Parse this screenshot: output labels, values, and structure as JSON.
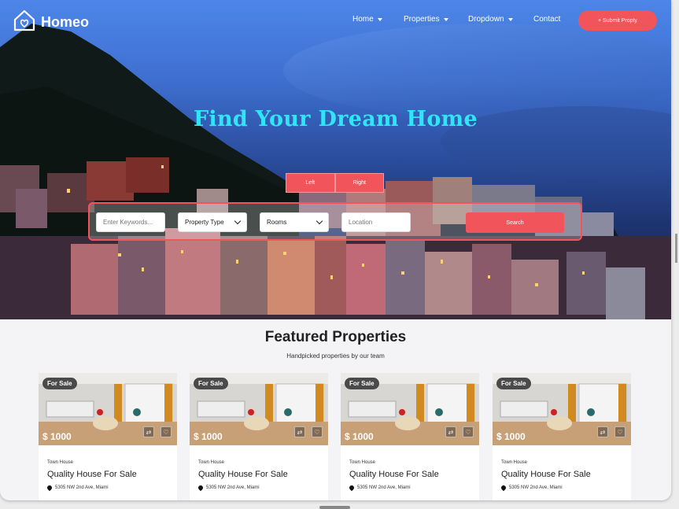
{
  "brand": {
    "name": "Homeo"
  },
  "nav": {
    "items": [
      {
        "label": "Home",
        "has_dropdown": true
      },
      {
        "label": "Properties",
        "has_dropdown": true
      },
      {
        "label": "Dropdown",
        "has_dropdown": true
      },
      {
        "label": "Contact",
        "has_dropdown": false
      }
    ],
    "submit_label": "+ Submit Propty"
  },
  "hero": {
    "title": "Find Your Dream Home",
    "toggle": {
      "left": "Left",
      "right": "Right"
    },
    "search": {
      "keywords_placeholder": "Enter Keywords...",
      "property_type": "Property Type",
      "rooms": "Rooms",
      "location_placeholder": "Location",
      "button": "Search"
    }
  },
  "featured": {
    "title": "Featured Properties",
    "subtitle": "Handpicked properties by our team",
    "cards": [
      {
        "badge": "For Sale",
        "price": "$ 1000",
        "type": "Town House",
        "title": "Quality House For Sale",
        "address": "5305   NW 2nd Ave, Miami"
      },
      {
        "badge": "For Sale",
        "price": "$ 1000",
        "type": "Town House",
        "title": "Quality House For Sale",
        "address": "5305   NW 2nd Ave, Miami"
      },
      {
        "badge": "For Sale",
        "price": "$ 1000",
        "type": "Town House",
        "title": "Quality House For Sale",
        "address": "5305   NW 2nd Ave, Miami"
      },
      {
        "badge": "For Sale",
        "price": "$ 1000",
        "type": "Town House",
        "title": "Quality House For Sale",
        "address": "5305   NW 2nd Ave, Miami"
      }
    ]
  },
  "colors": {
    "accent": "#f2545b",
    "title": "#2fe6f7",
    "sky": "#4d86e8"
  },
  "icons": [
    "house-heart-icon",
    "caret-down-icon",
    "chevron-down-icon",
    "compare-icon",
    "favorite-icon",
    "map-pin-icon"
  ]
}
